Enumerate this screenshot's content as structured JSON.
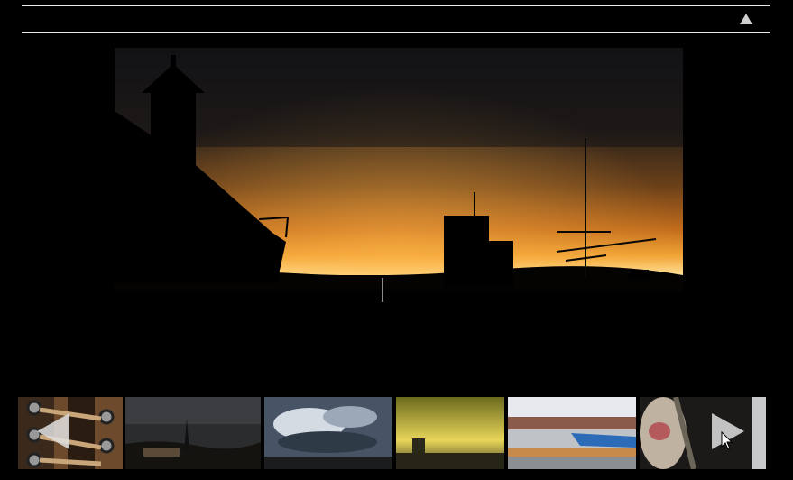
{
  "header": {
    "collapse_icon": "triangle-up-icon"
  },
  "viewer": {
    "image": "sunset-silhouette-rooftops-antenna"
  },
  "thumbnails": [
    {
      "subject": "shoe-laces-closeup"
    },
    {
      "subject": "dusk-town-church-spire"
    },
    {
      "subject": "dramatic-cloudy-sky"
    },
    {
      "subject": "yellow-sky-over-sea"
    },
    {
      "subject": "rooftops-blue-tarp"
    },
    {
      "subject": "horse-face-closeup"
    },
    {
      "subject": "partial-next-image"
    }
  ],
  "nav": {
    "prev_icon": "arrow-left-icon",
    "next_icon": "arrow-right-icon"
  },
  "colors": {
    "background": "#000000",
    "rule": "#eaeaea",
    "arrow": "#e1e1e1"
  }
}
